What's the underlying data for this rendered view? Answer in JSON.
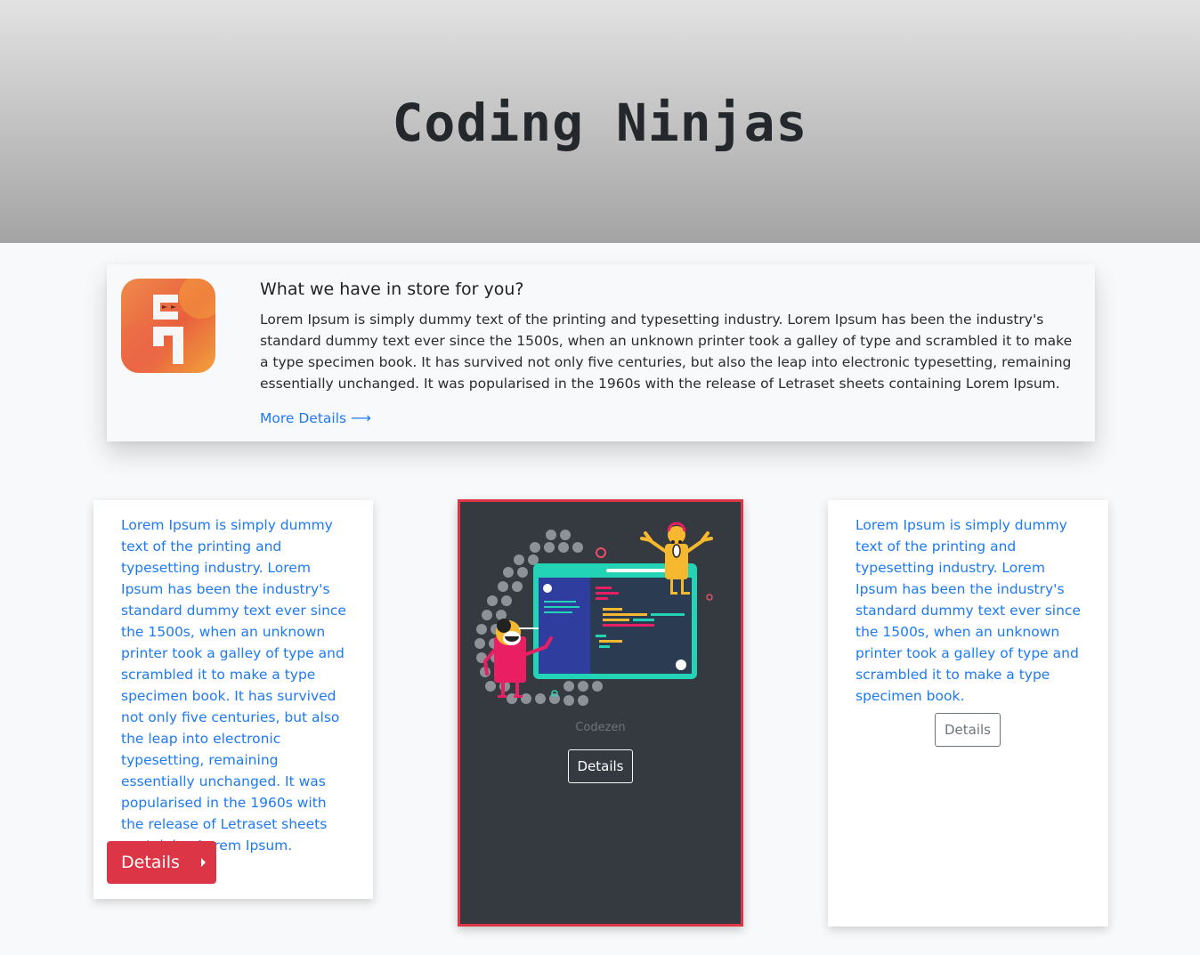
{
  "header": {
    "title": "Coding Ninjas"
  },
  "info": {
    "heading": "What we have in store for you?",
    "body": "Lorem Ipsum is simply dummy text of the printing and typesetting industry. Lorem Ipsum has been the industry's standard dummy text ever since the 1500s, when an unknown printer took a galley of type and scrambled it to make a type specimen book. It has survived not only five centuries, but also the leap into electronic typesetting, remaining essentially unchanged. It was popularised in the 1960s with the release of Letraset sheets containing Lorem Ipsum.",
    "link_label": "More Details",
    "link_icon": "long-arrow-right-icon"
  },
  "cards": {
    "left": {
      "text": "Lorem Ipsum is simply dummy text of the printing and typesetting industry. Lorem Ipsum has been the industry's standard dummy text ever since the 1500s, when an unknown printer took a galley of type and scrambled it to make a type specimen book. It has survived not only five centuries, but also the leap into electronic typesetting, remaining essentially unchanged. It was popularised in the 1960s with the release of Letraset sheets containing Lorem Ipsum.",
      "button_label": "Details",
      "button_icon": "caret-right-icon"
    },
    "center": {
      "caption": "Codezen",
      "button_label": "Details"
    },
    "right": {
      "text": "Lorem Ipsum is simply dummy text of the printing and typesetting industry. Lorem Ipsum has been the industry's standard dummy text ever since the 1500s, when an unknown printer took a galley of type and scrambled it to make a type specimen book.",
      "button_label": "Details"
    }
  },
  "colors": {
    "accent_blue": "#1d7af3",
    "danger_red": "#dc3545",
    "dark_card": "#343a40",
    "page_bg": "#f8f9fa"
  }
}
